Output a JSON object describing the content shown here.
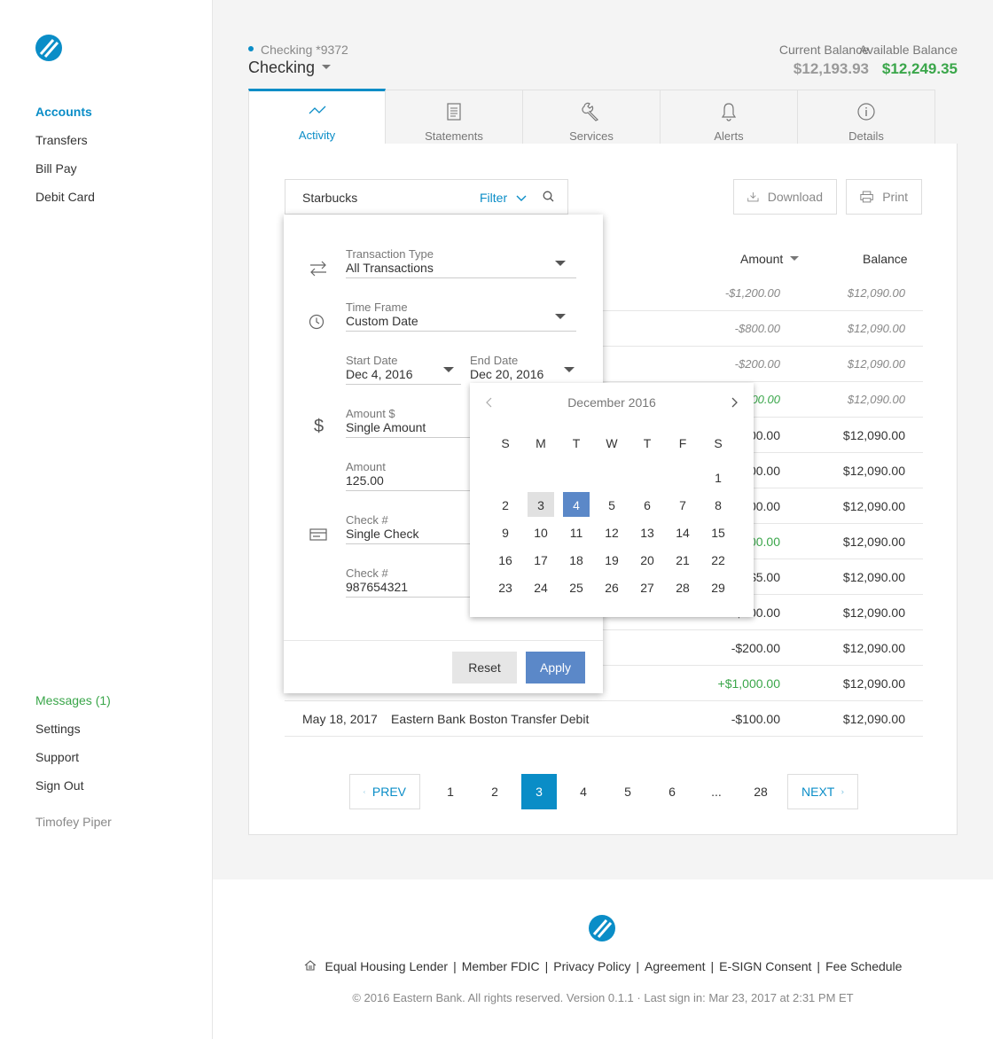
{
  "sidebar": {
    "nav": [
      "Accounts",
      "Transfers",
      "Bill Pay",
      "Debit Card"
    ],
    "messages": "Messages (1)",
    "nav2": [
      "Settings",
      "Support",
      "Sign Out"
    ],
    "user": "Timofey Piper"
  },
  "header": {
    "account_small": "Checking *9372",
    "account_name": "Checking",
    "current_balance_label": "Current Balance",
    "current_balance": "$12,193.93",
    "available_balance_label": "Available Balance",
    "available_balance": "$12,249.35"
  },
  "tabs": [
    "Activity",
    "Statements",
    "Services",
    "Alerts",
    "Details"
  ],
  "search": {
    "query": "Starbucks",
    "filter_label": "Filter"
  },
  "buttons": {
    "download": "Download",
    "print": "Print"
  },
  "table": {
    "col_amount": "Amount",
    "col_balance": "Balance",
    "rows": [
      {
        "date": "",
        "desc": "",
        "amount": "-$1,200.00",
        "balance": "$12,090.00",
        "pending": true
      },
      {
        "date": "",
        "desc": "",
        "amount": "-$800.00",
        "balance": "$12,090.00",
        "pending": true
      },
      {
        "date": "",
        "desc": "",
        "amount": "-$200.00",
        "balance": "$12,090.00",
        "pending": true
      },
      {
        "date": "",
        "desc": "",
        "amount": "+$1,500.00",
        "balance": "$12,090.00",
        "pending": true,
        "green": true
      },
      {
        "date": "",
        "desc": "",
        "amount": "-$100.00",
        "balance": "$12,090.00"
      },
      {
        "date": "",
        "desc": "",
        "amount": "-$100.00",
        "balance": "$12,090.00"
      },
      {
        "date": "",
        "desc": "",
        "amount": "-$100.00",
        "balance": "$12,090.00"
      },
      {
        "date": "",
        "desc": "",
        "amount": "+$100.00",
        "balance": "$12,090.00",
        "green": true
      },
      {
        "date": "",
        "desc": "",
        "amount": "-$5.00",
        "balance": "$12,090.00"
      },
      {
        "date": "",
        "desc": "",
        "amount": "-$100.00",
        "balance": "$12,090.00"
      },
      {
        "date": "",
        "desc": "",
        "amount": "-$200.00",
        "balance": "$12,090.00"
      },
      {
        "date": "",
        "desc": "",
        "amount": "+$1,000.00",
        "balance": "$12,090.00",
        "green": true
      },
      {
        "date": "May 18, 2017",
        "desc": "Eastern Bank Boston Transfer Debit",
        "amount": "-$100.00",
        "balance": "$12,090.00"
      }
    ]
  },
  "pager": {
    "prev": "PREV",
    "next": "NEXT",
    "pages": [
      "1",
      "2",
      "3",
      "4",
      "5",
      "6",
      "...",
      "28"
    ],
    "active": "3"
  },
  "filter": {
    "transaction_type_label": "Transaction Type",
    "transaction_type": "All Transactions",
    "time_frame_label": "Time Frame",
    "time_frame": "Custom Date",
    "start_date_label": "Start Date",
    "start_date": "Dec 4, 2016",
    "end_date_label": "End Date",
    "end_date": "Dec 20, 2016",
    "amount_type_label": "Amount $",
    "amount_type": "Single Amount",
    "amount_label": "Amount",
    "amount": "125.00",
    "check_type_label": "Check #",
    "check_type": "Single Check",
    "check_num_label": "Check #",
    "check_num": "987654321",
    "reset": "Reset",
    "apply": "Apply"
  },
  "calendar": {
    "title": "December 2016",
    "dow": [
      "S",
      "M",
      "T",
      "W",
      "T",
      "F",
      "S"
    ],
    "weeks": [
      [
        "",
        "",
        "",
        "",
        "",
        "",
        "1"
      ],
      [
        "2",
        "3",
        "4",
        "5",
        "6",
        "7",
        "8"
      ],
      [
        "9",
        "10",
        "11",
        "12",
        "13",
        "14",
        "15"
      ],
      [
        "16",
        "17",
        "18",
        "19",
        "20",
        "21",
        "22"
      ],
      [
        "23",
        "24",
        "25",
        "26",
        "27",
        "28",
        "29"
      ]
    ],
    "today": "3",
    "selected": "4"
  },
  "footer": {
    "links": [
      "Equal Housing Lender",
      "Member FDIC",
      "Privacy Policy",
      "Agreement",
      "E-SIGN Consent",
      "Fee Schedule"
    ],
    "copyright": "© 2016 Eastern Bank. All rights reserved. Version 0.1.1 · Last sign in: Mar 23, 2017 at 2:31 PM ET"
  },
  "colors": {
    "accent": "#0a8dc7",
    "green": "#3aa64a",
    "apply": "#5b88c8"
  }
}
